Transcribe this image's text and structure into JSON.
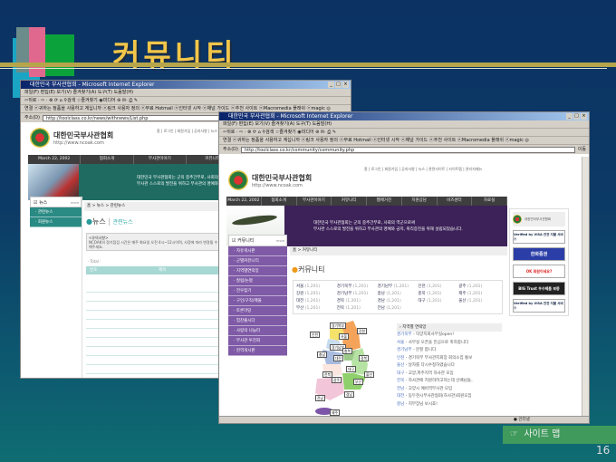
{
  "slide": {
    "title": "커뮤니티",
    "page_number": "16",
    "sitemap_label": "사이트 맵",
    "sitemap_icon": "pointing-hand-icon"
  },
  "colors": {
    "title": "#f2c64a",
    "purple": "#7f5aa6",
    "teal": "#2a8a84",
    "sitemap": "#3f9a5c"
  },
  "browser_common": {
    "title": "대한민국 부사관협회 - Microsoft Internet Explorer",
    "menu": "파일(F)  편집(E)  보기(V)  즐겨찾기(A)  도구(T)  도움말(H)",
    "toolbar": "⇦뒤로 · ⇨ · ⊗ ⟳ ⌂  ⚲검색  ☆즐겨찾기  ◉미디어  ⊛  ✉· ⎙ ✎",
    "links": "연결  ⓔ귀하는 정품을 사용하고 계십니까  ⓔ링크 사용자 정의  ⓔ무료 Hotmail  ⓔ인터넷 시작  ⓔ채널 가이드  ⓔ추천 사이트  ⓔMacromedia 플래쉬  ⓔmagic ◎",
    "address_label": "주소(D)",
    "go": "이동",
    "site_name": "대한민국부사관협회",
    "site_url": "http://www.ncoak.com",
    "top_links": "홈 | 로그인 | 회원가입 | 공지사항 | 뉴스 | 관련사이트 | 사이트맵 | 관리자메뉴",
    "nav": [
      "March 22, 2002",
      "협회소개",
      "부사관이야기",
      "커뮤니티",
      "웹매거진",
      "지원상담",
      "비즈센터",
      "자료실"
    ],
    "banner": [
      "대한민국 부사관협회는 군의 중추간부로, 사회의 역군으로써",
      "부사관 스스로의 발전을 위하고 부사관의 명예와 긍지, 복리증진을 위해 설립되었습니다."
    ]
  },
  "back_window": {
    "address": "http://toolclass.co.kr/news/withnews/List.php",
    "side_title": "뉴스",
    "more": "more",
    "side_items": [
      "관련뉴스",
      "회원뉴스"
    ],
    "breadcrumb": "홈 > 뉴스 > 관련뉴스",
    "heading": "뉴스",
    "subheading": "관련뉴스",
    "notice_title": "<유의사항>",
    "notice_text": "NCOAK의 정기점검 시간은 매주 화요일 오전 4시~12시이며, 사정에 따라 변경될 수 있습니다. 운영자는 운영자들을 방치지 않습니다. 운영자로 사용하는 분들 보시면 신고해주세요.",
    "total": "· Total :",
    "table_headers": [
      "번호",
      "제목"
    ]
  },
  "front_window": {
    "address": "http://toolclass.co.kr/community/community.php",
    "side_title": "커뮤니티",
    "more": "more",
    "side_items": [
      "자유게시판",
      "군별커뮤니티",
      "지역별연락망",
      "칼럼/논평",
      "전우찾기",
      "구인/구직/매물",
      "토론마당",
      "힘찬출시다",
      "사랑의 나눔터",
      "부사관 투진회",
      "현역게시판"
    ],
    "breadcrumb": "홈 > 커뮤니티",
    "heading": "커뮤니티",
    "regions": [
      {
        "name": "서울",
        "count": "(1,201)"
      },
      {
        "name": "경기북부",
        "count": "(1,201)"
      },
      {
        "name": "경기남부",
        "count": "(1,201)"
      },
      {
        "name": "인천",
        "count": "(1,201)"
      },
      {
        "name": "광주",
        "count": "(1,201)"
      },
      {
        "name": "강원",
        "count": "(1,201)"
      },
      {
        "name": "경기남부",
        "count": "(1,201)"
      },
      {
        "name": "충남",
        "count": "(1,201)"
      },
      {
        "name": "충북",
        "count": "(1,201)"
      },
      {
        "name": "제주",
        "count": "(1,201)"
      },
      {
        "name": "대전",
        "count": "(1,201)"
      },
      {
        "name": "경북",
        "count": "(1,201)"
      },
      {
        "name": "경남",
        "count": "(1,201)"
      },
      {
        "name": "대구",
        "count": "(1,201)"
      },
      {
        "name": "울산",
        "count": "(1,201)"
      },
      {
        "name": "부산",
        "count": "(1,201)"
      },
      {
        "name": "전북",
        "count": "(1,201)"
      },
      {
        "name": "전남",
        "count": "(1,201)"
      }
    ],
    "map_labels": [
      "경기북부",
      "인천",
      "서울",
      "강원",
      "경기남부",
      "충북",
      "충남",
      "대전",
      "경북",
      "대구",
      "전북",
      "울산",
      "광주",
      "부산",
      "경남",
      "전남",
      "제주"
    ],
    "news_title": "지역별 연락망",
    "news": [
      {
        "region": "경기북부",
        "text": " - 덕양지회사무실open!"
      },
      {
        "region": "서울",
        "text": " - 사무실 오픈을 진심으로 축하합니다"
      },
      {
        "region": "경기남부",
        "text": " - 분할 합니다."
      },
      {
        "region": "인천",
        "text": " - 경기북부 부사관지회장 회의소집 통보"
      },
      {
        "region": "울산",
        "text": " - 날자를 다시수정하였습니다"
      },
      {
        "region": "대구",
        "text": " - 고양,파주지역 하사관 모임"
      },
      {
        "region": "전북",
        "text": " - 하사관에 지원하려고하는데 선배님들.."
      },
      {
        "region": "전남",
        "text": " - 고양시 예비역부사관 모임"
      },
      {
        "region": "대전",
        "text": " - 동두천시부사관협회(하사관)회원모집"
      },
      {
        "region": "충남",
        "text": " - 지부장님 보시죠!"
      }
    ],
    "right_logo": "대한민국부사관협회",
    "ads": [
      "Verified by VISA 안전 지불 서비스",
      "한화증권",
      "OK 회원이세요?",
      "BIG Trust 우수제품 보증",
      "Verified by VISA 안전 지불 서비스"
    ],
    "status": "인터넷"
  }
}
